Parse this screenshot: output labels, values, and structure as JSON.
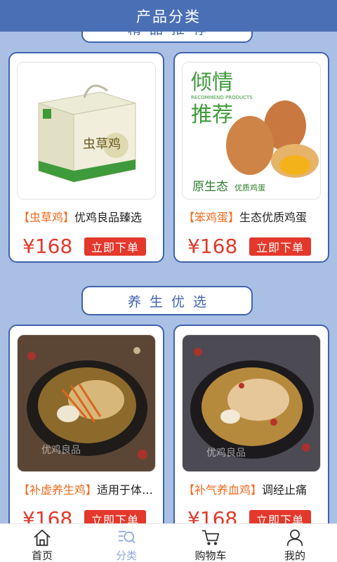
{
  "header": {
    "title": "产品分类"
  },
  "sections": [
    {
      "title": "精品推荐"
    },
    {
      "title": "养生优选"
    }
  ],
  "products": [
    {
      "tag": "【虫草鸡】",
      "desc": "优鸡良品臻选",
      "price": "¥168",
      "buy": "立即下单",
      "image_text": "虫草鸡"
    },
    {
      "tag": "【笨鸡蛋】",
      "desc": "生态优质鸡蛋",
      "price": "¥168",
      "buy": "立即下单",
      "image_text": {
        "l1": "倾情",
        "l2": "推荐",
        "sub": "RECOMMEND PRODUCTS",
        "b1": "原生态",
        "b2": "优质鸡蛋"
      }
    },
    {
      "tag": "【补虚养生鸡】",
      "desc": "适用于体虚人群",
      "price": "¥168",
      "buy": "立即下单",
      "watermark": "优鸡良品"
    },
    {
      "tag": "【补气养血鸡】",
      "desc": "调经止痛",
      "price": "¥168",
      "buy": "立即下单",
      "watermark": "优鸡良品"
    }
  ],
  "tabbar": [
    {
      "label": "首页",
      "icon": "home-icon"
    },
    {
      "label": "分类",
      "icon": "category-search-icon",
      "active": true
    },
    {
      "label": "购物车",
      "icon": "cart-icon"
    },
    {
      "label": "我的",
      "icon": "user-icon"
    }
  ],
  "colors": {
    "header": "#4a6fb4",
    "background": "#a9c0e4",
    "accent": "#e3382b",
    "tag": "#ee6a1f"
  }
}
